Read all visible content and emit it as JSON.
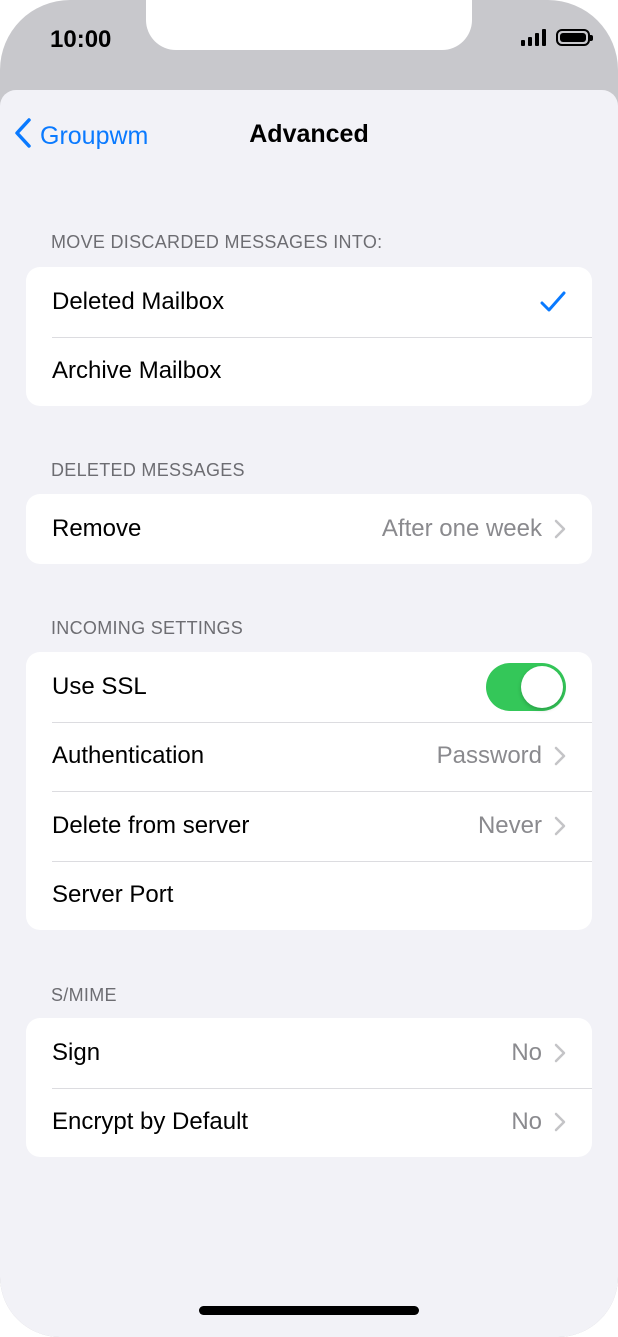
{
  "status_bar": {
    "time": "10:00"
  },
  "nav": {
    "back_label": "Groupwm",
    "title": "Advanced"
  },
  "sections": {
    "discarded": {
      "header": "MOVE DISCARDED MESSAGES INTO:",
      "items": [
        {
          "label": "Deleted Mailbox",
          "selected": true
        },
        {
          "label": "Archive Mailbox",
          "selected": false
        }
      ]
    },
    "deleted": {
      "header": "DELETED MESSAGES",
      "remove_label": "Remove",
      "remove_value": "After one week"
    },
    "incoming": {
      "header": "INCOMING SETTINGS",
      "ssl_label": "Use SSL",
      "ssl_on": true,
      "auth_label": "Authentication",
      "auth_value": "Password",
      "delete_label": "Delete from server",
      "delete_value": "Never",
      "port_label": "Server Port"
    },
    "smime": {
      "header": "S/MIME",
      "sign_label": "Sign",
      "sign_value": "No",
      "encrypt_label": "Encrypt by Default",
      "encrypt_value": "No"
    }
  },
  "colors": {
    "accent": "#0a7aff",
    "toggle_on": "#34c759",
    "background": "#f2f2f7"
  }
}
